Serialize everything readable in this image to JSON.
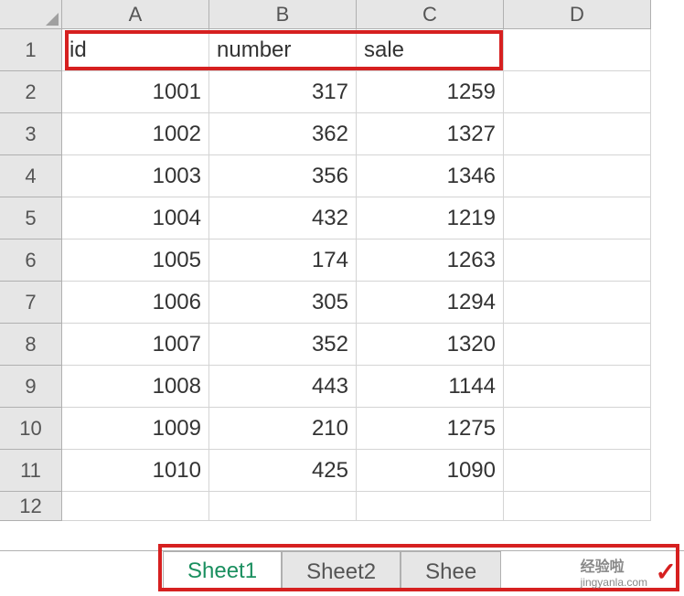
{
  "columns": [
    "A",
    "B",
    "C",
    "D"
  ],
  "row_numbers": [
    "1",
    "2",
    "3",
    "4",
    "5",
    "6",
    "7",
    "8",
    "9",
    "10",
    "11",
    "12"
  ],
  "headers": {
    "a": "id",
    "b": "number",
    "c": "sale"
  },
  "chart_data": {
    "type": "table",
    "columns": [
      "id",
      "number",
      "sale"
    ],
    "rows": [
      {
        "id": 1001,
        "number": 317,
        "sale": 1259
      },
      {
        "id": 1002,
        "number": 362,
        "sale": 1327
      },
      {
        "id": 1003,
        "number": 356,
        "sale": 1346
      },
      {
        "id": 1004,
        "number": 432,
        "sale": 1219
      },
      {
        "id": 1005,
        "number": 174,
        "sale": 1263
      },
      {
        "id": 1006,
        "number": 305,
        "sale": 1294
      },
      {
        "id": 1007,
        "number": 352,
        "sale": 1320
      },
      {
        "id": 1008,
        "number": 443,
        "sale": 1144
      },
      {
        "id": 1009,
        "number": 210,
        "sale": 1275
      },
      {
        "id": 1010,
        "number": 425,
        "sale": 1090
      }
    ]
  },
  "tabs": {
    "sheet1": "Sheet1",
    "sheet2": "Sheet2",
    "sheet3": "Shee"
  },
  "watermark_top": "经验啦",
  "watermark_bottom": "jingyanla.com",
  "checkmark": "✓"
}
